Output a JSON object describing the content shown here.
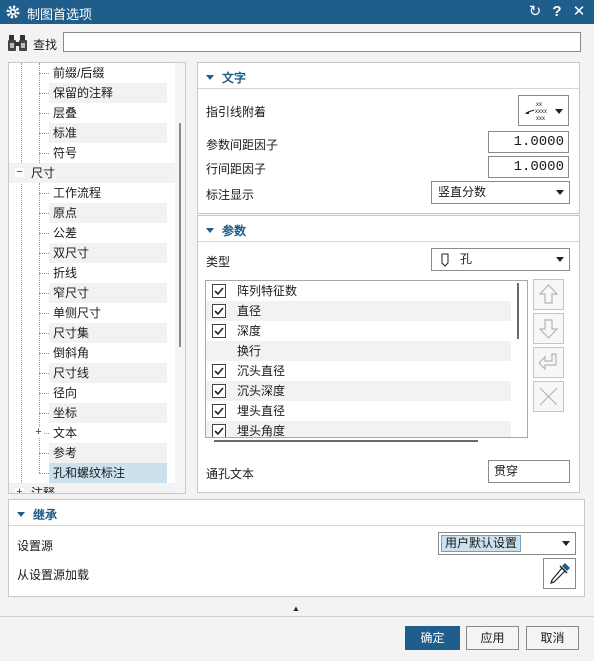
{
  "window": {
    "title": "制图首选项",
    "controls": [
      "reset-icon",
      "help-icon",
      "close-icon"
    ],
    "help_glyph": "?",
    "close_glyph": "✕",
    "reset_glyph": "↻"
  },
  "search": {
    "label": "查找",
    "value": ""
  },
  "tree": {
    "items": [
      {
        "label": "前缀/后缀",
        "level": 2
      },
      {
        "label": "保留的注释",
        "level": 2
      },
      {
        "label": "层叠",
        "level": 2
      },
      {
        "label": "标准",
        "level": 2
      },
      {
        "label": "符号",
        "level": 2
      },
      {
        "label": "尺寸",
        "level": 1,
        "expanded": true
      },
      {
        "label": "工作流程",
        "level": 2
      },
      {
        "label": "原点",
        "level": 2
      },
      {
        "label": "公差",
        "level": 2
      },
      {
        "label": "双尺寸",
        "level": 2
      },
      {
        "label": "折线",
        "level": 2
      },
      {
        "label": "窄尺寸",
        "level": 2
      },
      {
        "label": "单侧尺寸",
        "level": 2
      },
      {
        "label": "尺寸集",
        "level": 2
      },
      {
        "label": "倒斜角",
        "level": 2
      },
      {
        "label": "尺寸线",
        "level": 2
      },
      {
        "label": "径向",
        "level": 2
      },
      {
        "label": "坐标",
        "level": 2
      },
      {
        "label": "文本",
        "level": 2,
        "collapsed": true
      },
      {
        "label": "参考",
        "level": 2
      },
      {
        "label": "孔和螺纹标注",
        "level": 2,
        "selected": true
      },
      {
        "label": "注释",
        "level": 1,
        "collapsed": true
      }
    ]
  },
  "text_section": {
    "title": "文字",
    "leader_attach_label": "指引线附着",
    "leader_attach_icon": "leader-attachment-icon",
    "param_spacing_label": "参数间距因子",
    "param_spacing_value": "1.0000",
    "line_spacing_label": "行间距因子",
    "line_spacing_value": "1.0000",
    "display_label": "标注显示",
    "display_value": "竖直分数"
  },
  "param_section": {
    "title": "参数",
    "type_label": "类型",
    "type_value": "孔",
    "type_icon": "hole-icon",
    "list": [
      {
        "label": "阵列特征数",
        "checked": true
      },
      {
        "label": "直径",
        "checked": true
      },
      {
        "label": "深度",
        "checked": true
      },
      {
        "label": "换行",
        "checked": null
      },
      {
        "label": "沉头直径",
        "checked": true
      },
      {
        "label": "沉头深度",
        "checked": true
      },
      {
        "label": "埋头直径",
        "checked": true
      },
      {
        "label": "埋头角度",
        "checked": true
      }
    ],
    "side_buttons": [
      "move-up-icon",
      "move-down-icon",
      "insert-linebreak-icon",
      "delete-icon"
    ],
    "thru_text_label": "通孔文本",
    "thru_text_value": "贯穿"
  },
  "inherit_section": {
    "title": "继承",
    "source_label": "设置源",
    "source_value": "用户默认设置",
    "load_label": "从设置源加载",
    "load_icon": "eyedropper-icon"
  },
  "footer": {
    "collapse_glyph": "▲",
    "ok_label": "确定",
    "apply_label": "应用",
    "cancel_label": "取消"
  },
  "colors": {
    "accent": "#1f5d8a",
    "selected_row": "#cce1ee",
    "source_highlight": "#cce1ee"
  }
}
